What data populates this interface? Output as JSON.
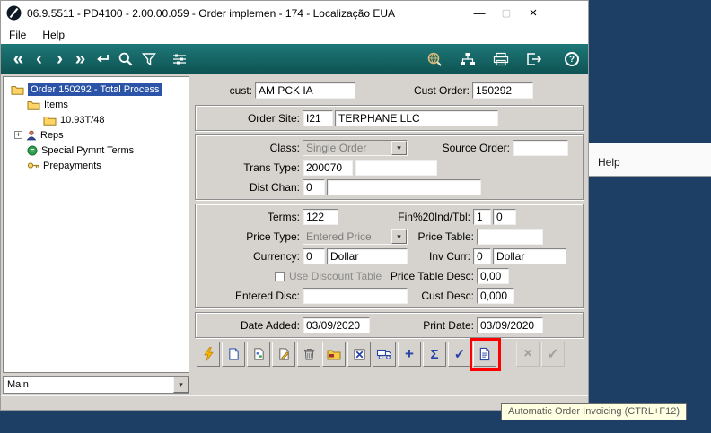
{
  "desktop": {
    "background_window_menu": "Help"
  },
  "window": {
    "title": "06.9.5511 - PD4100 - 2.00.00.059 - Order implemen - 174 - Localização EUA",
    "minimize": "—",
    "maximize": "▢",
    "close": "×"
  },
  "menubar": {
    "file": "File",
    "help": "Help"
  },
  "toolbar": {
    "nav": [
      {
        "name": "first",
        "glyph": "«"
      },
      {
        "name": "previous",
        "glyph": "‹"
      },
      {
        "name": "next",
        "glyph": "›"
      },
      {
        "name": "last",
        "glyph": "»"
      }
    ],
    "help_glyph": "?"
  },
  "tree": {
    "expand_glyph": "+",
    "items": [
      {
        "label": "Order 150292 - Total Process",
        "selected": true
      },
      {
        "label": "Items"
      },
      {
        "label": "10.93T/48"
      },
      {
        "label": "Reps"
      },
      {
        "label": "Special Pymnt Terms"
      },
      {
        "label": "Prepayments"
      }
    ],
    "mode": "Main"
  },
  "ui": {
    "dropdown_arrow": "▾"
  },
  "form": {
    "cust": {
      "label": "cust:",
      "value": "AM PCK IA"
    },
    "cust_order": {
      "label": "Cust Order:",
      "value": "150292"
    },
    "order_site": {
      "label": "Order Site:",
      "code": "I21",
      "name": "TERPHANE LLC"
    },
    "class": {
      "label": "Class:",
      "value": "Single Order"
    },
    "source_order": {
      "label": "Source Order:",
      "value": ""
    },
    "trans_type": {
      "label": "Trans Type:",
      "value": "200070",
      "desc": ""
    },
    "dist_chan": {
      "label": "Dist Chan:",
      "value": "0",
      "desc": ""
    },
    "terms": {
      "label": "Terms:",
      "value": "122"
    },
    "fin_ind": {
      "label": "Fin%20Ind/Tbl:",
      "value1": "1",
      "value2": "0"
    },
    "price_type": {
      "label": "Price Type:",
      "value": "Entered Price"
    },
    "price_table": {
      "label": "Price Table:",
      "value": ""
    },
    "currency": {
      "label": "Currency:",
      "code": "0",
      "name": "Dollar"
    },
    "inv_curr": {
      "label": "Inv Curr:",
      "code": "0",
      "name": "Dollar"
    },
    "use_discount": {
      "label": "Use Discount Table",
      "checked": false
    },
    "price_table_desc": {
      "label": "Price Table Desc:",
      "value": "0,00"
    },
    "entered_disc": {
      "label": "Entered Disc:",
      "value": ""
    },
    "cust_desc": {
      "label": "Cust Desc:",
      "value": "0,000"
    },
    "date_added": {
      "label": "Date Added:",
      "value": "03/09/2020"
    },
    "print_date": {
      "label": "Print Date:",
      "value": "03/09/2020"
    }
  },
  "actions": {
    "buttons": [
      {
        "name": "run"
      },
      {
        "name": "new-record"
      },
      {
        "name": "copy-record"
      },
      {
        "name": "edit-record"
      },
      {
        "name": "delete-record"
      },
      {
        "name": "documents-folder"
      },
      {
        "name": "cancel-order"
      },
      {
        "name": "shipping"
      },
      {
        "name": "add-line",
        "glyph": "+"
      },
      {
        "name": "totals",
        "glyph": "Σ"
      },
      {
        "name": "confirm",
        "glyph": "✓"
      },
      {
        "name": "auto-invoice",
        "highlighted": true
      },
      {
        "name": "cancel",
        "glyph": "×",
        "disabled": true
      },
      {
        "name": "ok",
        "glyph": "✓",
        "disabled": true
      }
    ]
  },
  "tooltip": {
    "text": "Automatic Order Invoicing (CTRL+F12)"
  },
  "annotation": {
    "color": "#ff0000",
    "target": "auto-invoice-button"
  }
}
